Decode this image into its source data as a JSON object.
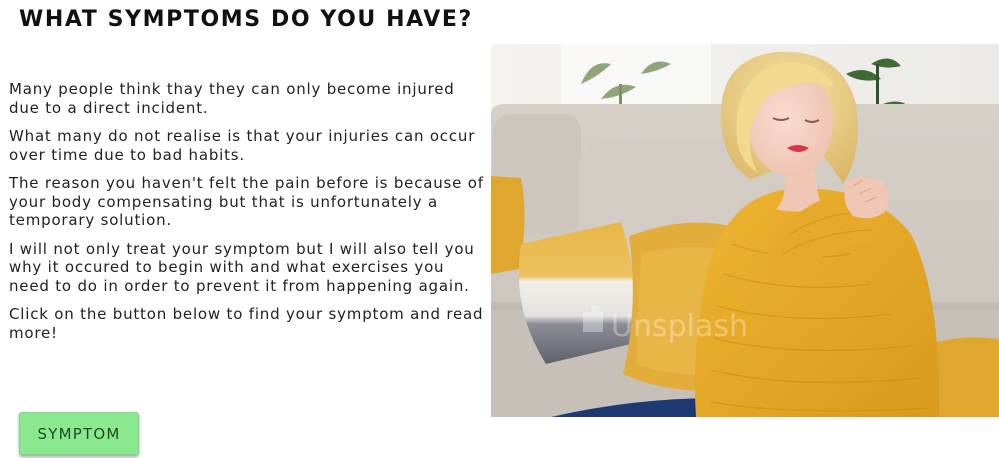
{
  "section": {
    "title": "WHAT SYMPTOMS DO YOU HAVE?",
    "paragraphs": [
      "Many people think thay they can only become injured due to a direct incident.",
      "What many do not realise is that your injuries can occur over time due to bad habits.",
      "The reason you haven't felt the pain before is because of your body compensating but that is unfortunately a temporary solution.",
      "I will not only treat your symptom but I will also tell you why it occured to begin with and what exercises you need to do in order to prevent it from happening again.",
      "Click on the button below to find your symptom and read more!"
    ],
    "button_label": "SYMPTOM"
  },
  "photo": {
    "watermark": "Unsplash"
  },
  "colors": {
    "button_bg": "#8ae98f",
    "button_text": "#1f4a22",
    "sweater": "#e7a92a",
    "sofa": "#cfc9c2"
  }
}
